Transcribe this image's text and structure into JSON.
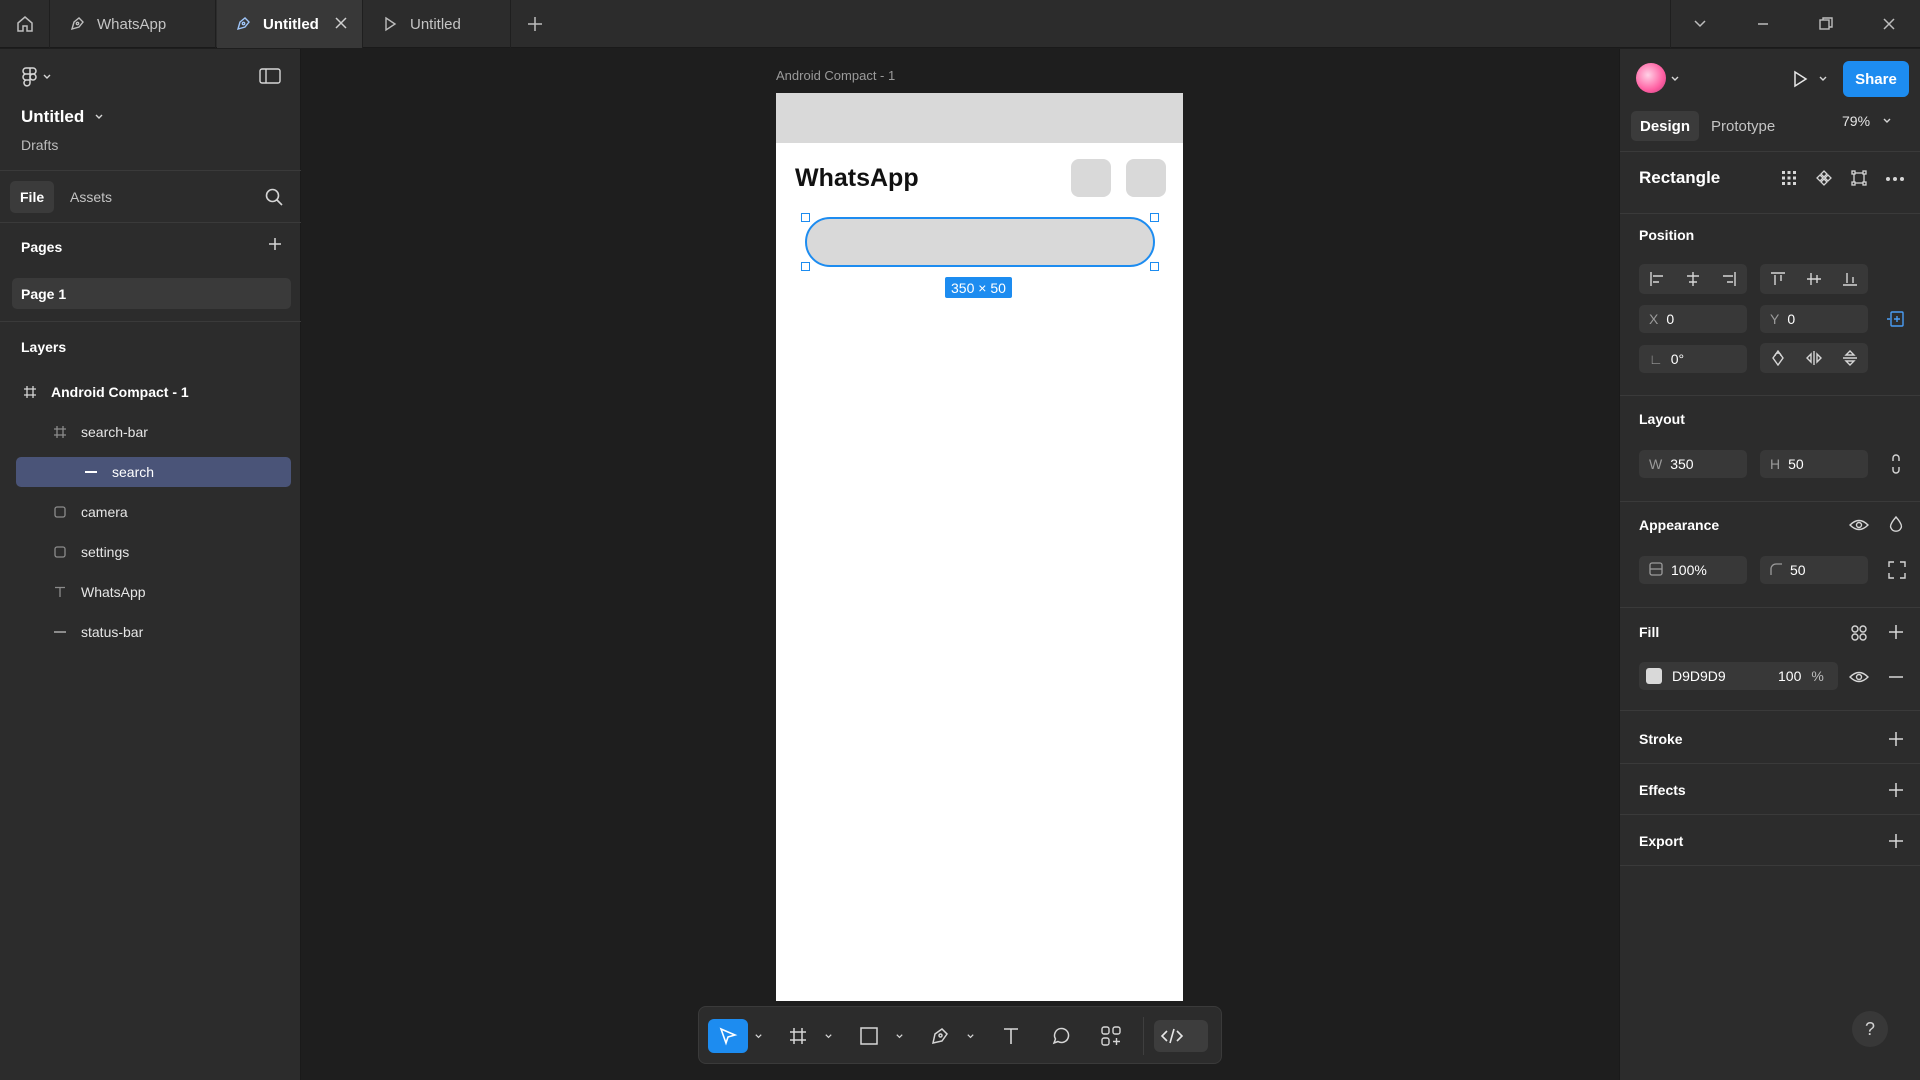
{
  "tabs": [
    {
      "label": "WhatsApp",
      "icon": "pen-icon"
    },
    {
      "label": "Untitled",
      "icon": "pen-icon",
      "active": true
    },
    {
      "label": "Untitled",
      "icon": "play-icon"
    }
  ],
  "left": {
    "project_title": "Untitled",
    "project_location": "Drafts",
    "tabs": [
      "File",
      "Assets"
    ],
    "pages_heading": "Pages",
    "pages": [
      "Page 1"
    ],
    "layers_heading": "Layers",
    "layers": [
      {
        "name": "Android Compact - 1",
        "icon": "frame-icon"
      },
      {
        "name": "search-bar",
        "icon": "frame-icon"
      },
      {
        "name": "search",
        "icon": "rectangle-line-icon"
      },
      {
        "name": "camera",
        "icon": "rectangle-icon"
      },
      {
        "name": "settings",
        "icon": "rectangle-icon"
      },
      {
        "name": "WhatsApp",
        "icon": "text-icon"
      },
      {
        "name": "status-bar",
        "icon": "rectangle-line-icon"
      }
    ]
  },
  "canvas": {
    "frame_label": "Android Compact - 1",
    "app_title": "WhatsApp",
    "dimension_badge": "350 × 50"
  },
  "right": {
    "share_label": "Share",
    "tabs": [
      "Design",
      "Prototype"
    ],
    "zoom": "79%",
    "selection_name": "Rectangle",
    "position": {
      "heading": "Position",
      "x_label": "X",
      "x": "0",
      "y_label": "Y",
      "y": "0",
      "rotation": "0°"
    },
    "layout": {
      "heading": "Layout",
      "w_label": "W",
      "w": "350",
      "h_label": "H",
      "h": "50"
    },
    "appearance": {
      "heading": "Appearance",
      "opacity": "100%",
      "radius": "50"
    },
    "fill": {
      "heading": "Fill",
      "hex": "D9D9D9",
      "opacity": "100",
      "unit": "%"
    },
    "stroke_heading": "Stroke",
    "effects_heading": "Effects",
    "export_heading": "Export",
    "help": "?"
  },
  "colors": {
    "accent": "#1d8cf0",
    "fill": "#D9D9D9",
    "selected_layer": "#4a5478"
  }
}
